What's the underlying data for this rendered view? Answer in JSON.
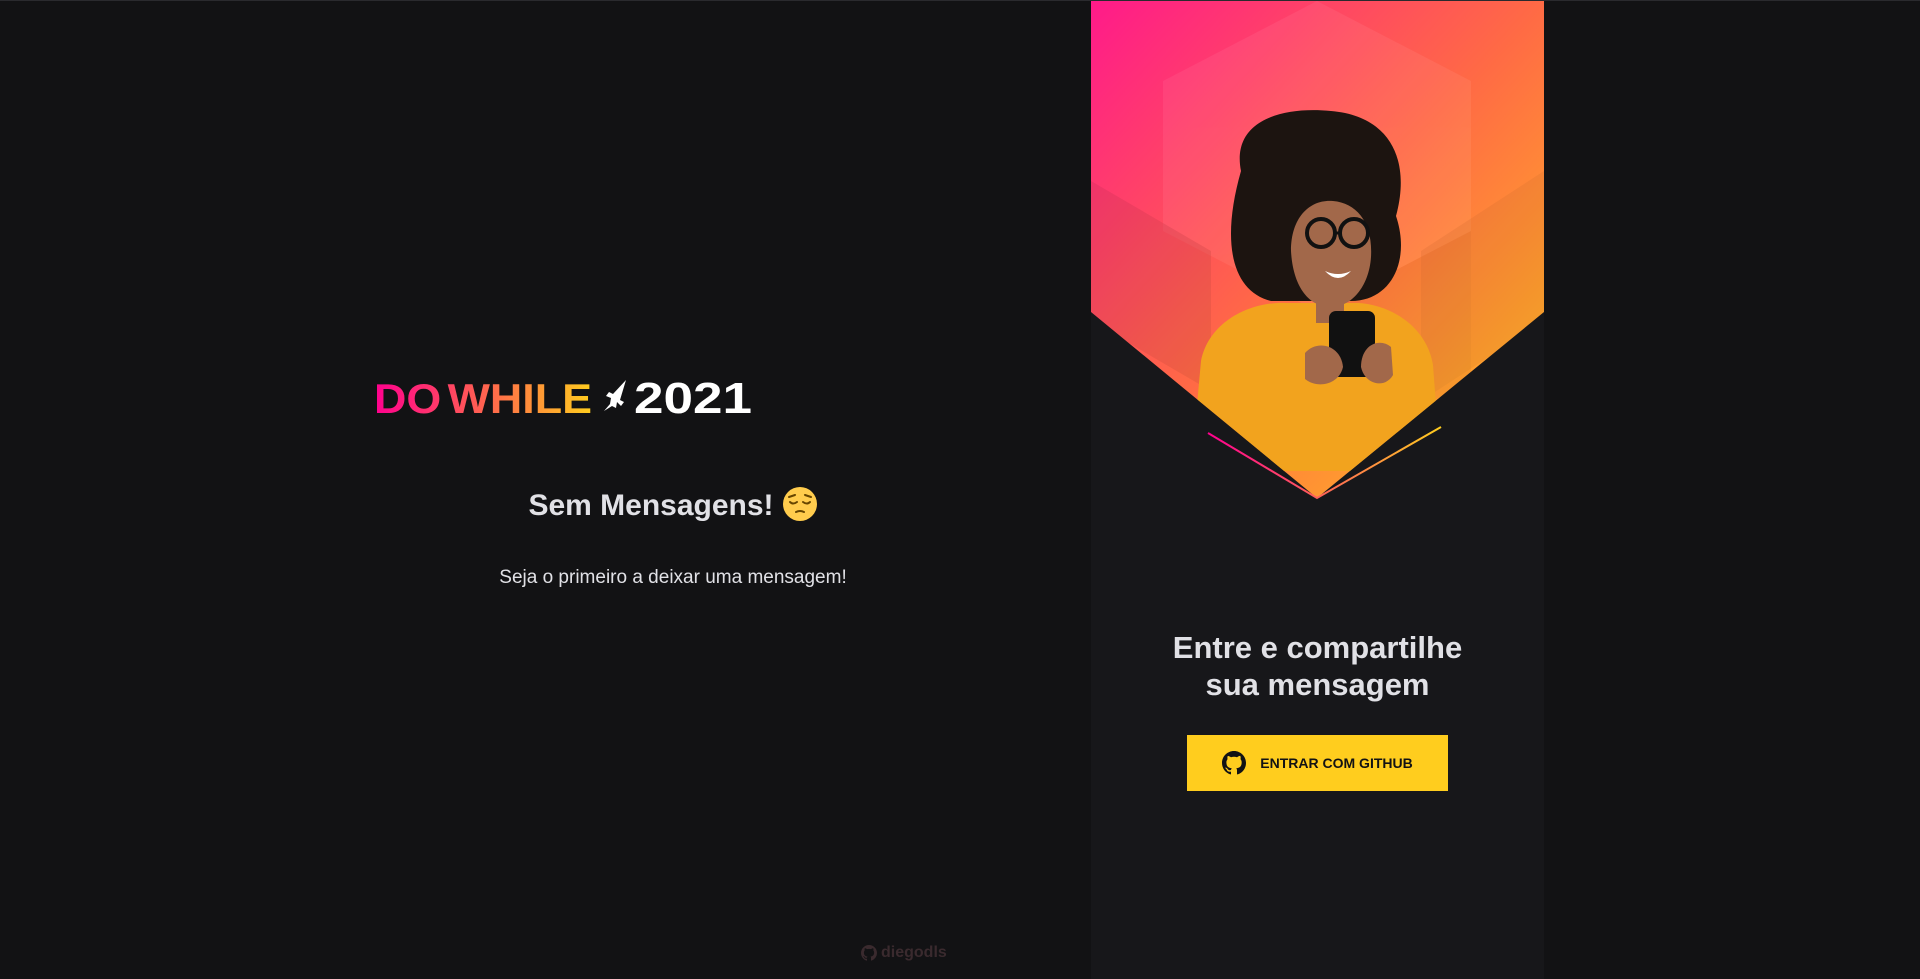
{
  "logo": {
    "do": "DO",
    "while": "WHILE",
    "year": "2021"
  },
  "messages": {
    "empty_title": "Sem Mensagens!",
    "empty_emoji": "pensive-face",
    "empty_subtitle": "Seja o primeiro a deixar uma mensagem!"
  },
  "login": {
    "title_line1": "Entre e compartilhe",
    "title_line2": "sua mensagem",
    "button_label": "ENTRAR COM GITHUB",
    "button_icon": "github-icon"
  },
  "footer": {
    "username": "diegodls",
    "icon": "github-icon"
  },
  "colors": {
    "background": "#121214",
    "panel": "#17171a",
    "button": "#ffcd1e",
    "text": "#e1e1e6",
    "gradient_start": "#ff008e",
    "gradient_mid": "#ff7a4a",
    "gradient_end": "#ffcd1e"
  }
}
